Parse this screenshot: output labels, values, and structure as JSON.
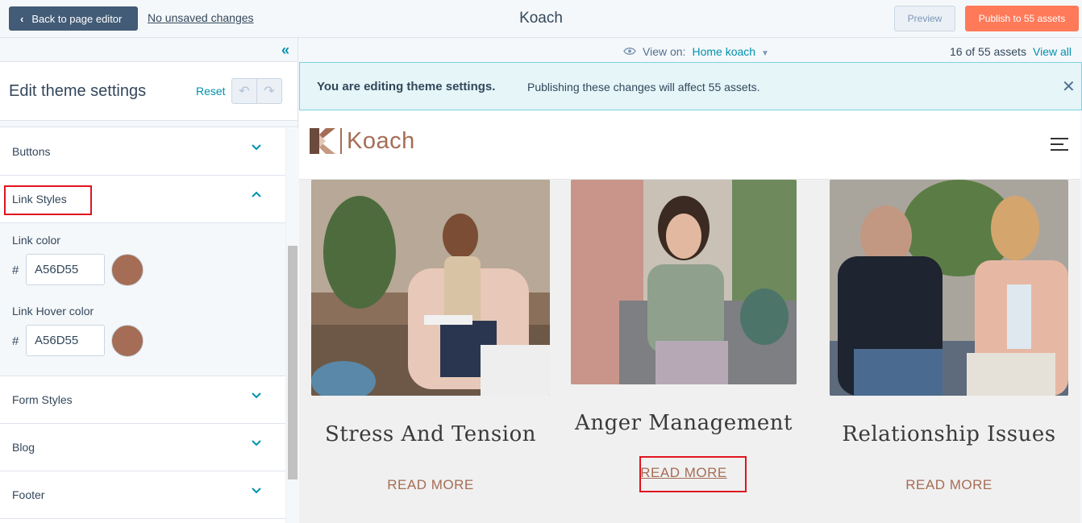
{
  "topbar": {
    "back_label": "Back to page editor",
    "unsaved_label": "No unsaved changes",
    "app_title": "Koach",
    "preview_label": "Preview",
    "publish_label": "Publish to 55 assets"
  },
  "sidebar": {
    "title": "Edit theme settings",
    "reset_label": "Reset",
    "sections": {
      "buttons": "Buttons",
      "link_styles": "Link Styles",
      "form_styles": "Form Styles",
      "blog": "Blog",
      "footer": "Footer"
    },
    "link_color": {
      "label": "Link color",
      "hash": "#",
      "value": "A56D55",
      "swatch": "#a56d55"
    },
    "link_hover_color": {
      "label": "Link Hover color",
      "hash": "#",
      "value": "A56D55",
      "swatch": "#a56d55"
    }
  },
  "viewbar": {
    "view_on_label": "View on:",
    "view_on_value": "Home koach",
    "asset_count": "16 of 55 assets",
    "view_all_label": "View all"
  },
  "banner": {
    "title": "You are editing theme settings.",
    "text": "Publishing these changes will affect 55 assets."
  },
  "site": {
    "logo_text": "Koach",
    "cards": [
      {
        "title": "Stress And Tension",
        "link": "READ MORE"
      },
      {
        "title": "Anger Management",
        "link": "READ MORE"
      },
      {
        "title": "Relationship Issues",
        "link": "READ MORE"
      }
    ]
  },
  "colors": {
    "accent": "#0091ae",
    "publish": "#ff7a59",
    "link": "#a56d55",
    "annotation": "#e0141e"
  }
}
